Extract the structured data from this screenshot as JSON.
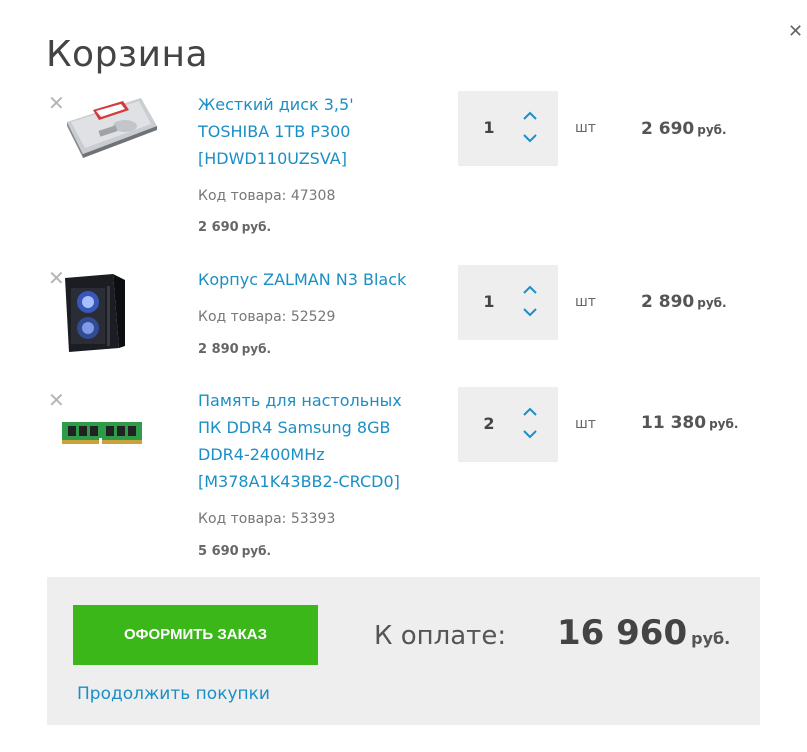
{
  "cart": {
    "title": "Корзина",
    "close_icon": "close-icon"
  },
  "items": [
    {
      "name": "Жесткий диск 3,5' TOSHIBA 1TB P300 [HDWD110UZSVA]",
      "code": "Код товара: 47308",
      "unit_price": "2 690",
      "currency": "руб.",
      "quantity": "1",
      "unit": "шт",
      "total": "2 690",
      "image": "hdd-image"
    },
    {
      "name": "Корпус ZALMAN N3 Black",
      "code": "Код товара: 52529",
      "unit_price": "2 890",
      "currency": "руб.",
      "quantity": "1",
      "unit": "шт",
      "total": "2 890",
      "image": "pc-case-image"
    },
    {
      "name": "Память для настольных ПК DDR4 Samsung 8GB DDR4-2400MHz [M378A1K43BB2-CRCD0]",
      "code": "Код товара: 53393",
      "unit_price": "5 690",
      "currency": "руб.",
      "quantity": "2",
      "unit": "шт",
      "total": "11 380",
      "image": "ram-module-image"
    }
  ],
  "footer": {
    "checkout_label": "ОФОРМИТЬ ЗАКАЗ",
    "total_label": "К оплате:",
    "total_value": "16 960",
    "total_currency": "руб.",
    "continue_label": "Продолжить покупки"
  },
  "colors": {
    "accent_link": "#1a8fc6",
    "checkout_button": "#3bb71a",
    "footer_bg": "#eeeeee"
  }
}
